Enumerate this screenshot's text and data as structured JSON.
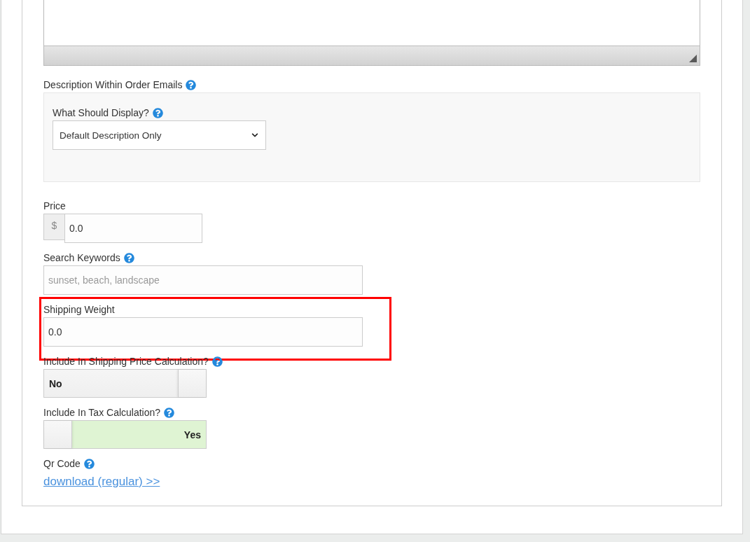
{
  "fields": [
    {
      "kind": "panel",
      "label": "Description Within Order Emails",
      "help": true,
      "highlighted": false,
      "fields": [
        {
          "kind": "select",
          "label": "What Should Display?",
          "help": true,
          "value": "Default Description Only",
          "highlighted": false
        }
      ]
    },
    {
      "kind": "price",
      "label": "Price",
      "help": false,
      "prefix": "$",
      "value": "0.0",
      "highlighted": false
    },
    {
      "kind": "text",
      "label": "Search Keywords",
      "help": true,
      "placeholder": "sunset, beach, landscape",
      "highlighted": false
    },
    {
      "kind": "text",
      "label": "Shipping Weight",
      "help": false,
      "value": "0.0",
      "highlighted": true
    },
    {
      "kind": "toggle",
      "label": "Include In Shipping Price Calculation?",
      "help": true,
      "on": false,
      "text": "No",
      "highlighted": false
    },
    {
      "kind": "toggle",
      "label": "Include In Tax Calculation?",
      "help": true,
      "on": true,
      "text": "Yes",
      "highlighted": false
    },
    {
      "kind": "link",
      "label": "Qr Code",
      "help": true,
      "link": "download (regular) >>",
      "highlighted": false
    }
  ]
}
